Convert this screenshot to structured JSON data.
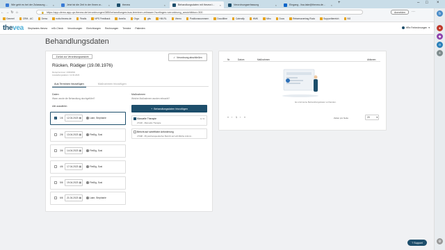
{
  "browser": {
    "tabs": [
      {
        "label": "Wie geht es bei der Zulassung ..."
      },
      {
        "label": "Jetzt ist die Zeit in der Ihnen w..."
      },
      {
        "label": "thevea"
      },
      {
        "label": "Behandlungsdaten mit thevea t..."
      },
      {
        "label": "Verordnungserfassung"
      },
      {
        "label": "Eingang - lisa.lake@thevea.de..."
      }
    ],
    "url": "https://app.demo.app.qa.thevea.de/verordnungen/385/behandlungen/aus-terminen-erfassen?sortingen=verordnung_ansichtbbox=300",
    "signin_label": "Anmelden",
    "bookmarks": [
      "Generel",
      "CRM - AC",
      "Demo",
      "notiz.thevea.de",
      "Finalis",
      "NPS Feedback",
      "Amelia",
      "Orga",
      "gitu",
      "HM-RL",
      "Vimeo",
      "Positionsnummern",
      "Docollibre",
      "Calendly",
      "HMK",
      "Miro",
      "Docs",
      "Reisemavertrag Rudo",
      "Supportbereich",
      "BG"
    ]
  },
  "app": {
    "logo_main": "the",
    "logo_accent": "vea",
    "nav": [
      "Stephanies thevea",
      "mSr-Check",
      "Verordnungen",
      "Einrichtungen",
      "Rechnungen",
      "Termine",
      "Patienten"
    ],
    "user": "HRe Fertenierungen"
  },
  "page": {
    "title": "Behandlungsdaten",
    "back_button": "Zurück zur Verordnungsansicht",
    "close_button": "Verordnung abschließen",
    "patient_name": "Rücken, Rüdiger (19.08.1976)",
    "meta_line1": "Rezeptnummer: 23302002",
    "meta_line2": "Ausstellungsdatum: 12.02.2023",
    "tab_active": "Aus Terminen hinzufügen",
    "tab_inactive": "Maßnahmen hinzufügen",
    "dates_label": "Daten",
    "dates_sub": "Wann wurde die Behandlung durchgeführt?",
    "select_all": "Alle auswählen",
    "rows": [
      {
        "num": "1/6",
        "date": "12.04.2023",
        "name": "Lake, Stephanie",
        "checked": true
      },
      {
        "num": "2/6",
        "date": "13.04.2023",
        "name": "Fleißig, Susi",
        "checked": false
      },
      {
        "num": "3/6",
        "date": "14.04.2023",
        "name": "Fleißig, Susi",
        "checked": false
      },
      {
        "num": "4/6",
        "date": "17.04.2023",
        "name": "Fleißig, Susi",
        "checked": false
      },
      {
        "num": "5/6",
        "date": "19.04.2023",
        "name": "Fleißig, Susi",
        "checked": false
      },
      {
        "num": "6/6",
        "date": "21.04.2023",
        "name": "Lake, Stephanie",
        "checked": false
      }
    ],
    "measures_label": "Maßnahmen",
    "measures_sub": "Welche Maßnahmen wurden erbracht?",
    "add_button": "Behandlungsdaten hinzufügen",
    "treatments": [
      {
        "title": "Manuelle Therapie",
        "detail": "27220 - Manuelle Therapie",
        "count": "0 / 6",
        "checked": true
      },
      {
        "title": "Bericht auf schriftliche Anforderung",
        "detail": "27908 - Physiotherapeutischer Bericht auf schriftliche Anford...",
        "count": "",
        "checked": false
      }
    ]
  },
  "table": {
    "headers": [
      "Nr.",
      "Datum",
      "Maßnahmen",
      "Aktionen"
    ],
    "empty_text": "Es sind keine Behandlungsdaten vorhanden.",
    "page_current": "1",
    "per_page_label": "Zeilen pro Seite",
    "per_page": "20"
  },
  "support_label": "Support"
}
